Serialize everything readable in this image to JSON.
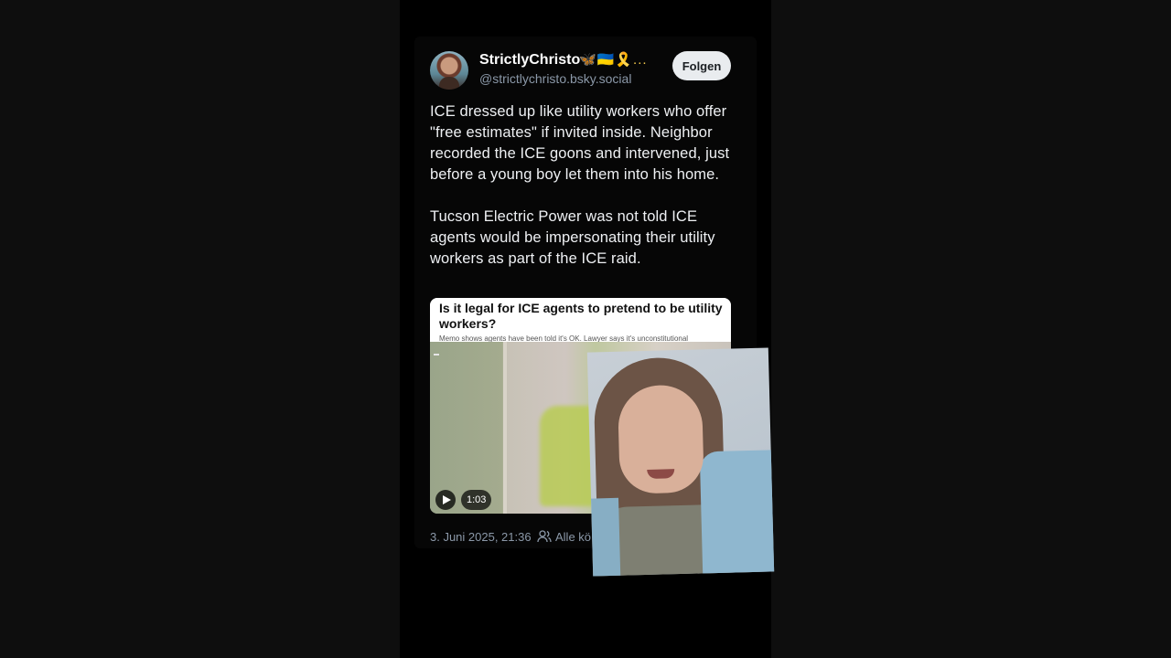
{
  "post": {
    "author_name": "StrictlyChristo",
    "author_emoji": "🦋🇺🇦🎗️...",
    "handle": "@strictlychristo.bsky.social",
    "follow_label": "Folgen",
    "text_paragraphs": [
      "ICE dressed up like utility workers who offer \"free estimates\" if invited inside. Neighbor recorded the ICE goons and intervened, just before a young boy let them into his home.",
      "Tucson Electric Power was not told ICE agents would be impersonating their utility workers as part of the ICE raid."
    ],
    "media": {
      "headline": "Is it legal for ICE agents to pretend to be utility workers?",
      "subhead": "Memo shows agents have been told it's OK. Lawyer says it's unconstitutional",
      "duration": "1:03"
    },
    "timestamp": "3. Juni 2025, 21:36",
    "audience": "Alle kö"
  }
}
